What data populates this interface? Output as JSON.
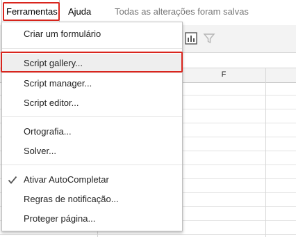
{
  "menubar": {
    "tools_label": "Ferramentas",
    "help_label": "Ajuda",
    "save_status": "Todas as alterações foram salvas"
  },
  "grid": {
    "column_label": "F"
  },
  "tools_menu": {
    "items": [
      {
        "label": "Criar um formulário"
      },
      {
        "label": "Script gallery..."
      },
      {
        "label": "Script manager..."
      },
      {
        "label": "Script editor..."
      },
      {
        "label": "Ortografia..."
      },
      {
        "label": "Solver..."
      },
      {
        "label": "Ativar AutoCompletar",
        "checked": true
      },
      {
        "label": "Regras de notificação..."
      },
      {
        "label": "Proteger página..."
      }
    ]
  },
  "icons": {
    "chart": "chart-icon",
    "filter": "filter-icon",
    "check": "checkmark-icon"
  },
  "colors": {
    "highlight": "#d9251d",
    "hover": "#eeeeee"
  }
}
